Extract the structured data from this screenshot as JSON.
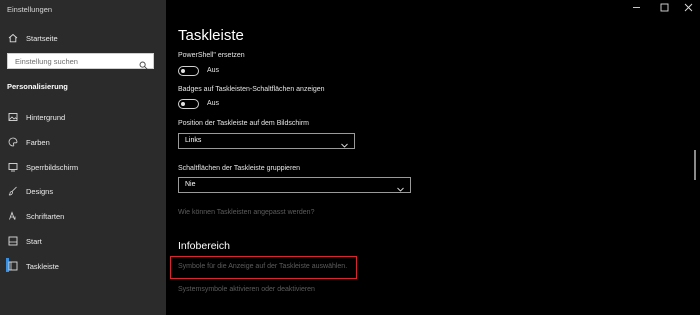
{
  "window": {
    "title": "Einstellungen",
    "controls": {
      "minimize": "—",
      "maximize": "☐",
      "close": "✕"
    }
  },
  "sidebar": {
    "home_label": "Startseite",
    "search_placeholder": "Einstellung suchen",
    "section_title": "Personalisierung",
    "items": [
      {
        "label": "Hintergrund",
        "icon": "image-icon"
      },
      {
        "label": "Farben",
        "icon": "palette-icon"
      },
      {
        "label": "Sperrbildschirm",
        "icon": "lockscreen-icon"
      },
      {
        "label": "Designs",
        "icon": "brush-icon"
      },
      {
        "label": "Schriftarten",
        "icon": "font-icon"
      },
      {
        "label": "Start",
        "icon": "start-icon"
      },
      {
        "label": "Taskleiste",
        "icon": "taskbar-icon",
        "selected": true
      }
    ]
  },
  "main": {
    "title": "Taskleiste",
    "powershell_label": "PowerShell\" ersetzen",
    "powershell_toggle": "Aus",
    "badges_label": "Badges auf Taskleisten-Schaltflächen anzeigen",
    "badges_toggle": "Aus",
    "position_label": "Position der Taskleiste auf dem Bildschirm",
    "position_value": "Links",
    "group_label": "Schaltflächen der Taskleiste gruppieren",
    "group_value": "Nie",
    "customize_link": "Wie können Taskleisten angepasst werden?",
    "infobereich_title": "Infobereich",
    "tray_icons_link": "Symbole für die Anzeige auf der Taskleiste auswählen.",
    "system_icons_link": "Systemsymbole aktivieren oder deaktivieren"
  },
  "colors": {
    "sidebar_bg": "#2b2b2b",
    "main_bg": "#000000",
    "accent": "#3b8fe0",
    "highlight_box": "#d9252e",
    "disabled_link": "#5c5c5c"
  }
}
